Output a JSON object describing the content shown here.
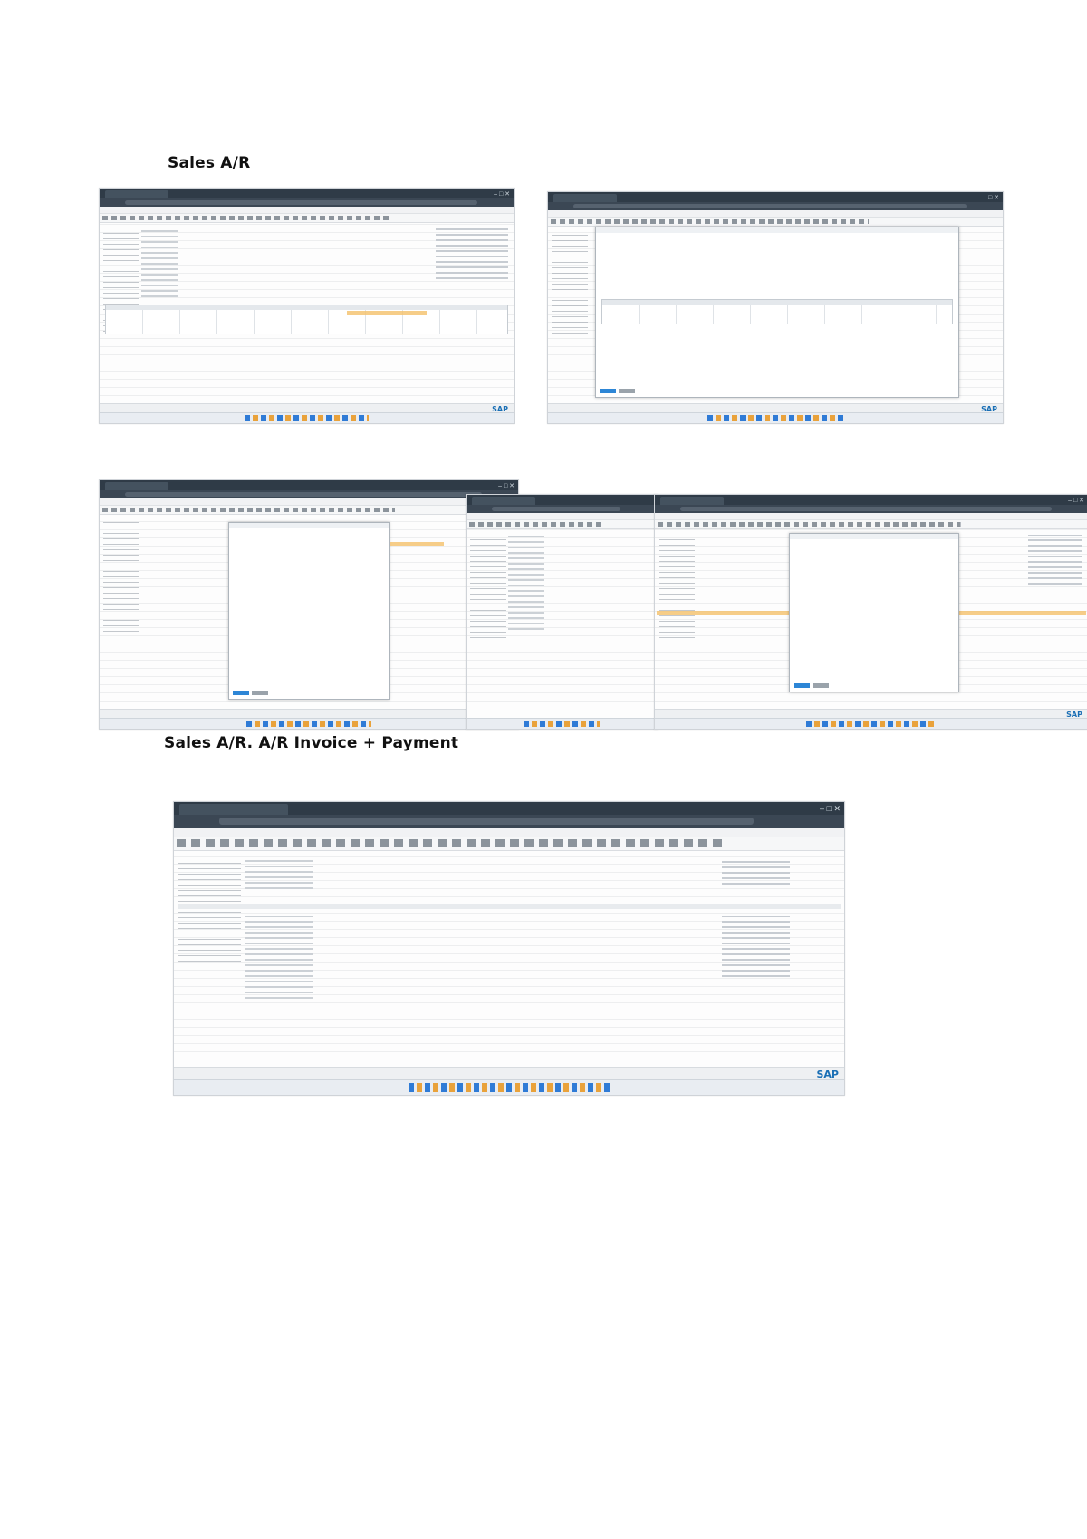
{
  "headings": {
    "section1": "Sales A/R",
    "section2": "Sales A/R. A/R Invoice + Payment"
  },
  "screenshots": [
    {
      "name": "sales-order-window",
      "has_dialog": false
    },
    {
      "name": "sales-copy-from-window",
      "has_dialog": true
    },
    {
      "name": "ar-invoice-window",
      "has_dialog": true
    },
    {
      "name": "incoming-payment-window-a",
      "has_dialog": false
    },
    {
      "name": "incoming-payment-window-b",
      "has_dialog": true
    },
    {
      "name": "business-partner-master-data-window",
      "has_dialog": false
    }
  ],
  "branding": {
    "logo_text": "SAP",
    "accent_color": "#1a6fb5",
    "highlight_color": "#f4c06a",
    "ok_button_color": "#2d86d6"
  }
}
